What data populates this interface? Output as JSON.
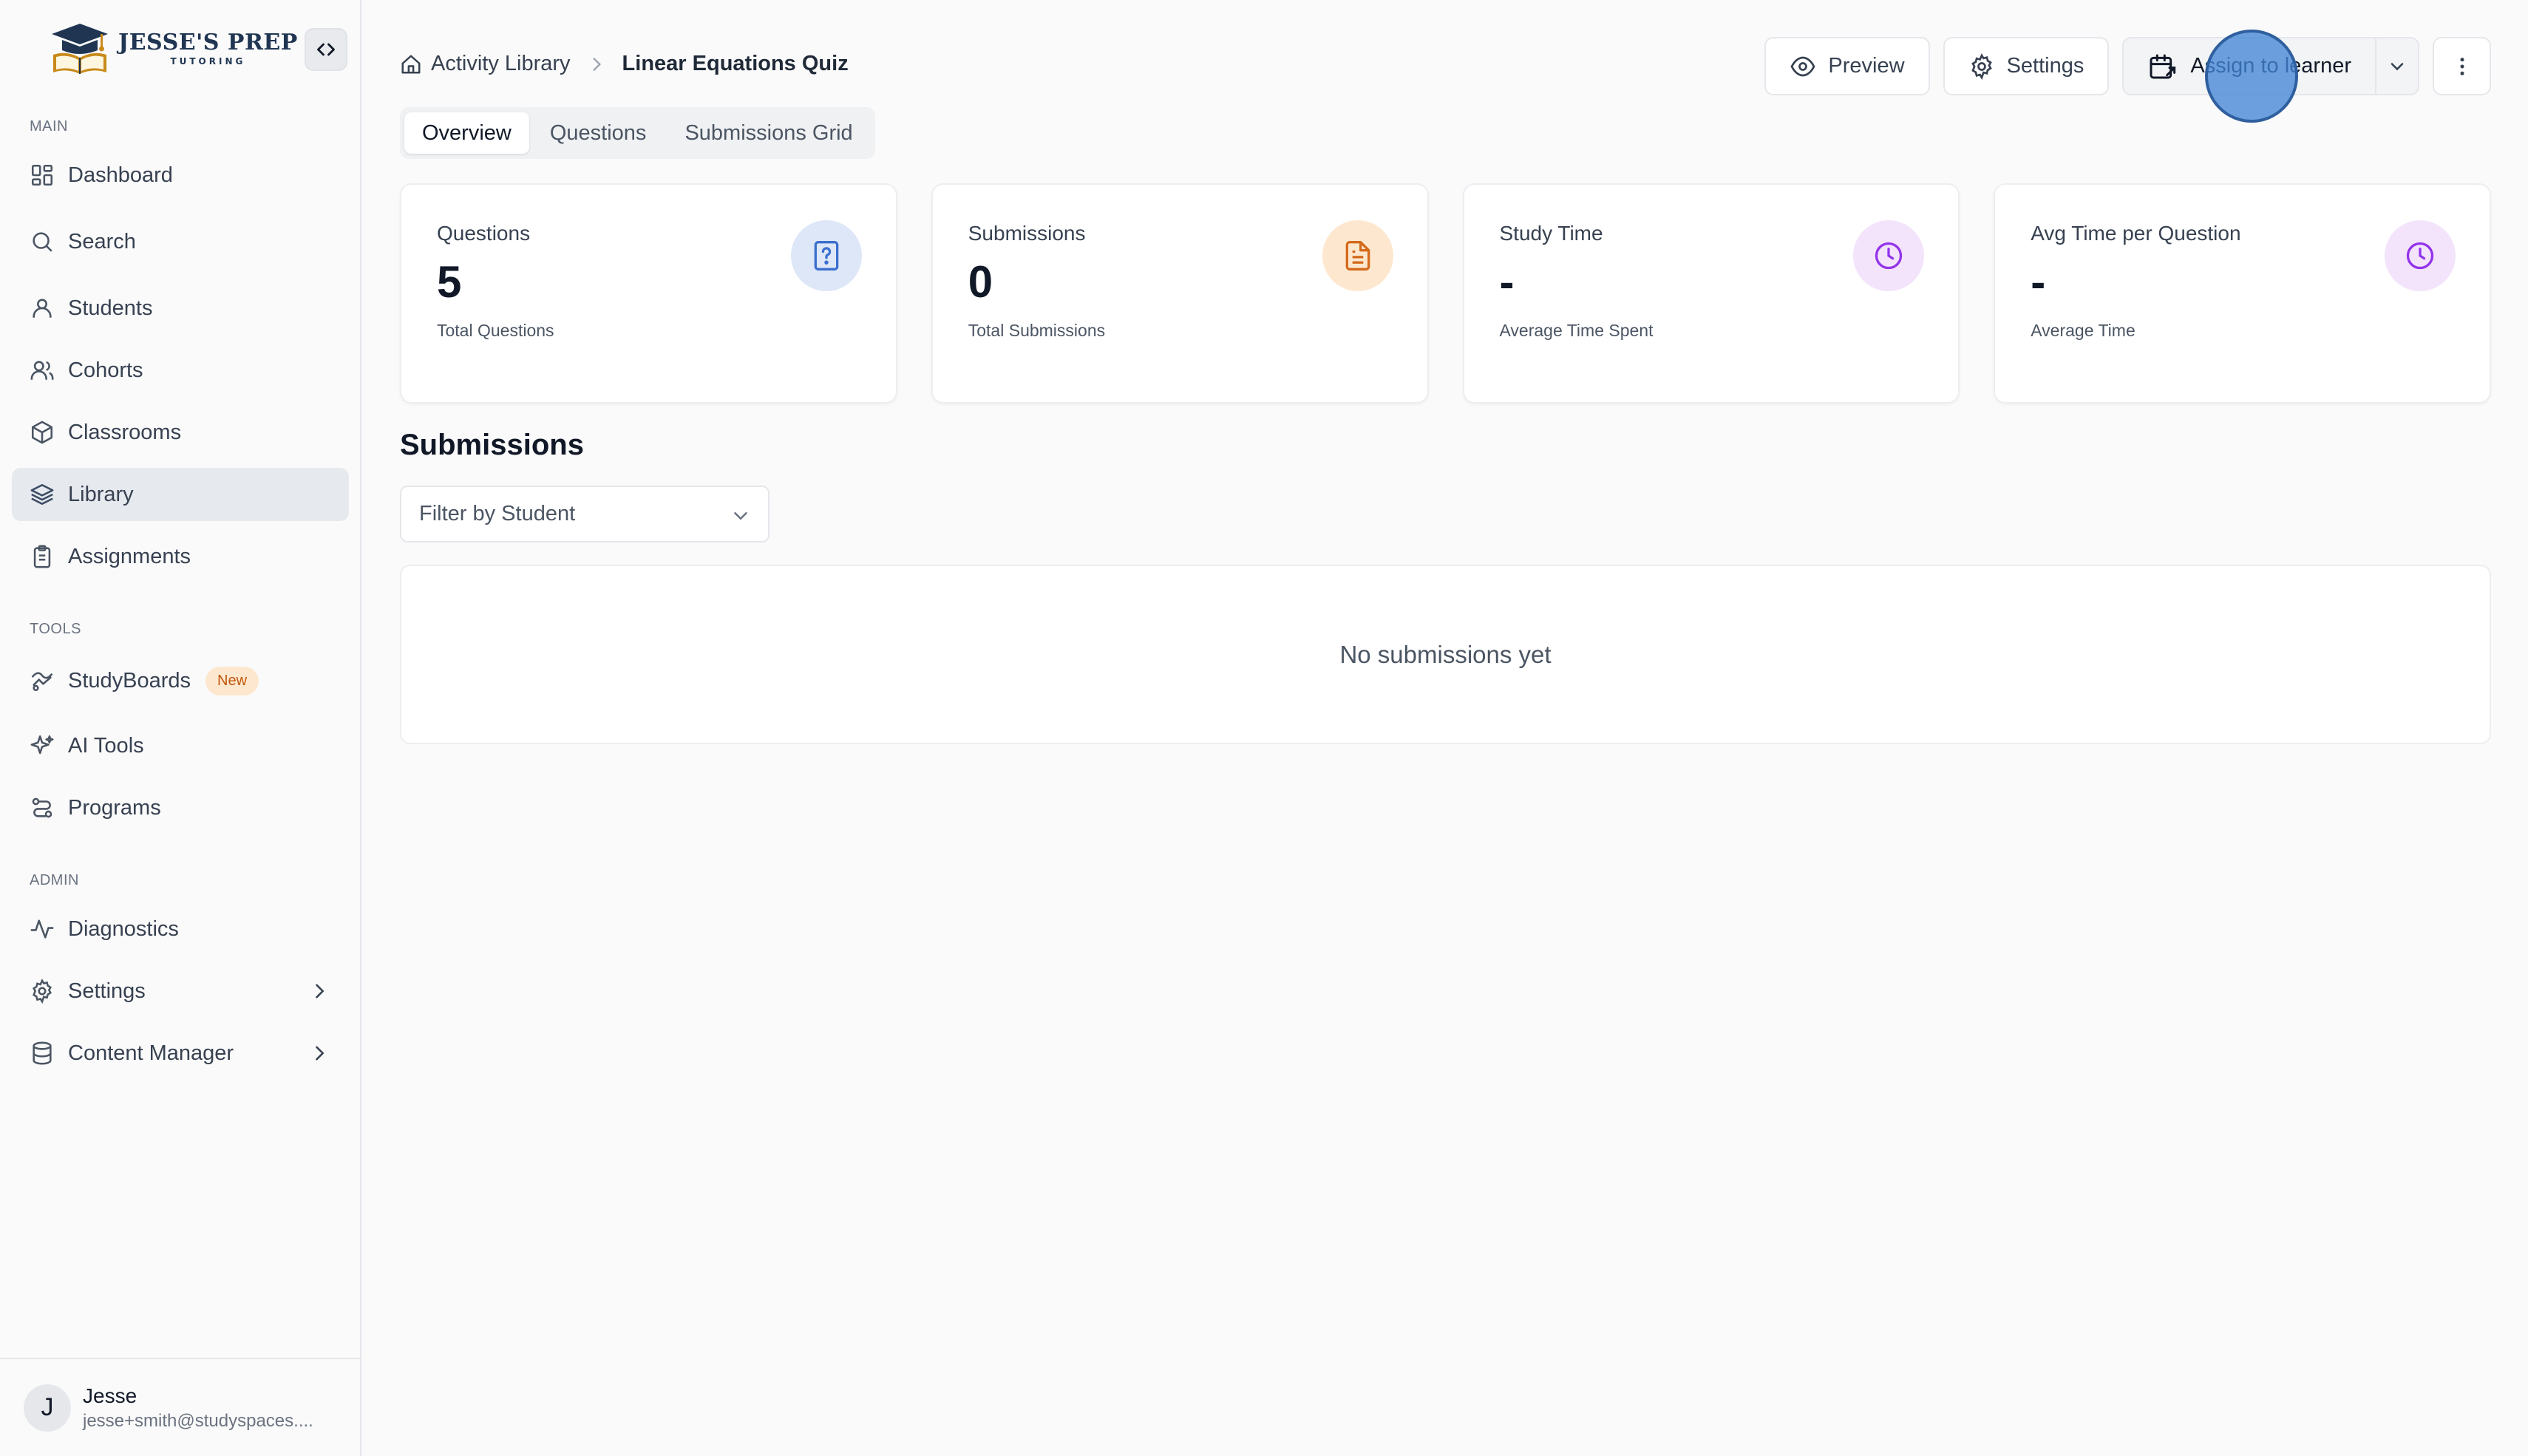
{
  "brand": {
    "title": "JESSE'S PREP",
    "subtitle": "TUTORING"
  },
  "sidebar": {
    "sections": [
      {
        "label": "MAIN"
      },
      {
        "label": "TOOLS"
      },
      {
        "label": "ADMIN"
      }
    ],
    "main_items": [
      {
        "label": "Dashboard",
        "icon": "dashboard-icon"
      },
      {
        "label": "Search",
        "icon": "search-icon"
      },
      {
        "label": "Students",
        "icon": "user-icon"
      },
      {
        "label": "Cohorts",
        "icon": "users-icon"
      },
      {
        "label": "Classrooms",
        "icon": "cube-icon"
      },
      {
        "label": "Library",
        "icon": "layers-icon",
        "active": true
      },
      {
        "label": "Assignments",
        "icon": "clipboard-icon"
      }
    ],
    "tools_items": [
      {
        "label": "StudyBoards",
        "icon": "studyboards-icon",
        "badge": "New"
      },
      {
        "label": "AI Tools",
        "icon": "sparkles-icon"
      },
      {
        "label": "Programs",
        "icon": "route-icon"
      }
    ],
    "admin_items": [
      {
        "label": "Diagnostics",
        "icon": "activity-icon"
      },
      {
        "label": "Settings",
        "icon": "gear-icon"
      },
      {
        "label": "Content Manager",
        "icon": "database-icon"
      }
    ],
    "user": {
      "initial": "J",
      "name": "Jesse",
      "email": "jesse+smith@studyspaces...."
    }
  },
  "breadcrumb": {
    "parent": "Activity Library",
    "current": "Linear Equations Quiz"
  },
  "actions": {
    "preview": "Preview",
    "settings": "Settings",
    "assign": "Assign to learner"
  },
  "tabs": [
    {
      "label": "Overview",
      "active": true
    },
    {
      "label": "Questions"
    },
    {
      "label": "Submissions Grid"
    }
  ],
  "stats": [
    {
      "title": "Questions",
      "value": "5",
      "sub": "Total Questions",
      "icon": "question-file-icon",
      "color": "#3b6fcf",
      "bg": "#dde7f7"
    },
    {
      "title": "Submissions",
      "value": "0",
      "sub": "Total Submissions",
      "icon": "document-icon",
      "color": "#d46a1b",
      "bg": "#fde8cf"
    },
    {
      "title": "Study Time",
      "value": "-",
      "sub": "Average Time Spent",
      "icon": "clock-icon",
      "color": "#9333ea",
      "bg": "#f3e4fb"
    },
    {
      "title": "Avg Time per Question",
      "value": "-",
      "sub": "Average Time",
      "icon": "clock-icon",
      "color": "#9333ea",
      "bg": "#f3e4fb"
    }
  ],
  "submissions": {
    "title": "Submissions",
    "filter_placeholder": "Filter by Student",
    "empty_text": "No submissions yet"
  }
}
